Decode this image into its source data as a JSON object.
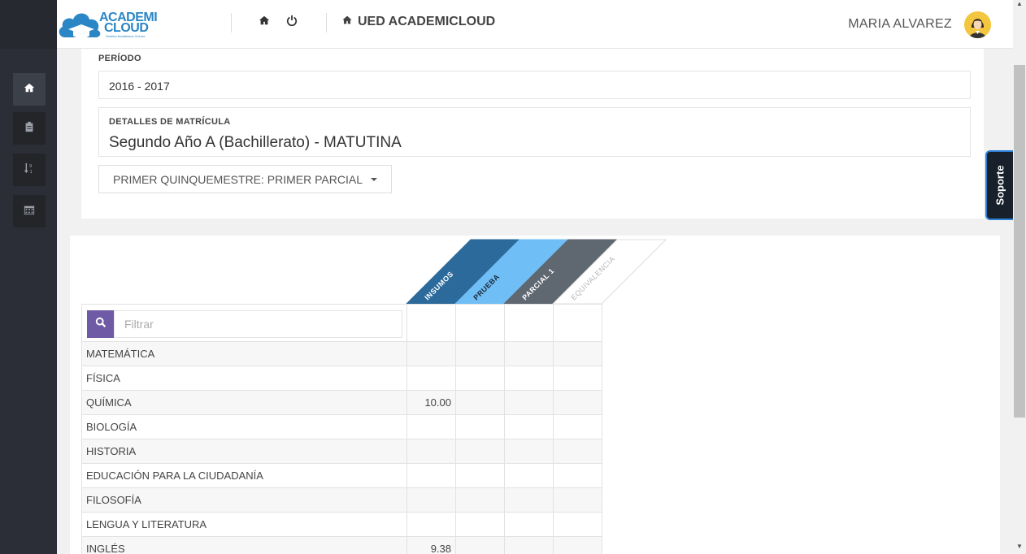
{
  "header": {
    "logo_line1": "ACADEMI",
    "logo_line2": "CLOUD",
    "logo_tagline": "Gestión Académica OnLine",
    "app_title": "UED ACADEMICLOUD",
    "user_name": "MARIA ALVAREZ"
  },
  "sidebar": {
    "items": [
      {
        "icon": "home-icon",
        "active": true
      },
      {
        "icon": "clipboard-icon",
        "active": false
      },
      {
        "icon": "sort-numeric-icon",
        "active": false
      },
      {
        "icon": "calendar-icon",
        "active": false
      }
    ]
  },
  "periodo": {
    "label": "PERÍODO",
    "value": "2016 - 2017"
  },
  "matricula": {
    "label": "DETALLES DE MATRÍCULA",
    "value": "Segundo Año A (Bachillerato) - MATUTINA"
  },
  "term_selector": {
    "value": "PRIMER QUINQUEMESTRE: PRIMER PARCIAL"
  },
  "soporte": {
    "label": "Soporte"
  },
  "grades": {
    "filter_placeholder": "Filtrar",
    "columns": [
      {
        "label": "INSUMOS",
        "color": "#2b6a9b",
        "text_color": "#ffffff"
      },
      {
        "label": "PRUEBA",
        "color": "#6fbef5",
        "text_color": "#1a2a3a"
      },
      {
        "label": "PARCIAL 1",
        "color": "#5f6771",
        "text_color": "#ffffff"
      },
      {
        "label": "EQUIVALENCIA",
        "color": "#ffffff",
        "text_color": "#b5b5b5"
      }
    ],
    "rows": [
      {
        "subject": "MATEMÁTICA",
        "insumos": "",
        "prueba": "",
        "parcial": "",
        "equivalencia": ""
      },
      {
        "subject": "FÍSICA",
        "insumos": "",
        "prueba": "",
        "parcial": "",
        "equivalencia": ""
      },
      {
        "subject": "QUÍMICA",
        "insumos": "10.00",
        "prueba": "",
        "parcial": "",
        "equivalencia": ""
      },
      {
        "subject": "BIOLOGÍA",
        "insumos": "",
        "prueba": "",
        "parcial": "",
        "equivalencia": ""
      },
      {
        "subject": "HISTORIA",
        "insumos": "",
        "prueba": "",
        "parcial": "",
        "equivalencia": ""
      },
      {
        "subject": "EDUCACIÓN PARA LA CIUDADANÍA",
        "insumos": "",
        "prueba": "",
        "parcial": "",
        "equivalencia": ""
      },
      {
        "subject": "FILOSOFÍA",
        "insumos": "",
        "prueba": "",
        "parcial": "",
        "equivalencia": ""
      },
      {
        "subject": "LENGUA Y LITERATURA",
        "insumos": "",
        "prueba": "",
        "parcial": "",
        "equivalencia": ""
      },
      {
        "subject": "INGLÉS",
        "insumos": "9.38",
        "prueba": "",
        "parcial": "",
        "equivalencia": ""
      }
    ]
  }
}
